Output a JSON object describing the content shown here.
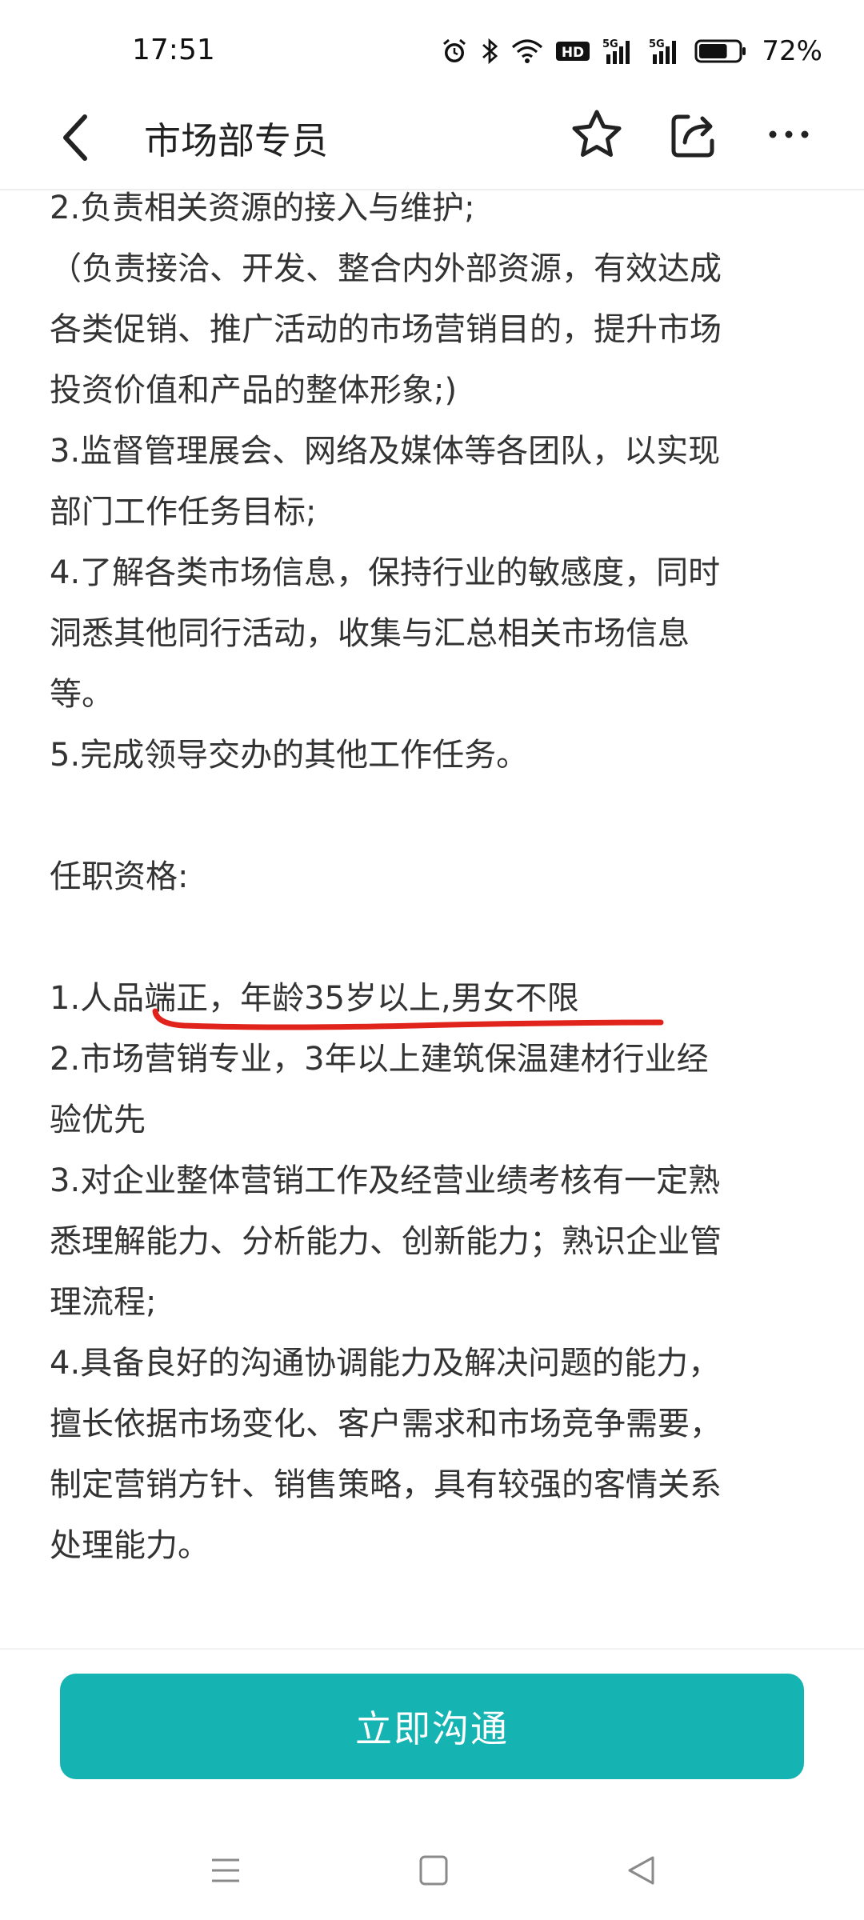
{
  "status_bar": {
    "time": "17:51",
    "network_labels": [
      "HD",
      "5G",
      "5G"
    ],
    "battery_percent": "72%",
    "battery_level": 0.72,
    "icons": [
      "alarm-icon",
      "bluetooth-icon",
      "wifi-icon",
      "hd-icon",
      "signal-5g-icon",
      "signal-5g-icon",
      "battery-icon"
    ]
  },
  "navbar": {
    "title": "市场部专员",
    "icons": [
      "back-arrow-icon",
      "star-icon",
      "share-icon",
      "more-icon"
    ]
  },
  "content": {
    "lines": [
      "2.负责相关资源的接入与维护;",
      "（负责接洽、开发、整合内外部资源，有效达成",
      "各类促销、推广活动的市场营销目的，提升市场",
      "投资价值和产品的整体形象;)",
      "3.监督管理展会、网络及媒体等各团队，以实现",
      "部门工作任务目标;",
      "4.了解各类市场信息，保持行业的敏感度，同时",
      "洞悉其他同行活动，收集与汇总相关市场信息",
      "等。",
      "5.完成领导交办的其他工作任务。",
      "",
      "任职资格:",
      "",
      "1.人品端正，年龄35岁以上,男女不限",
      "2.市场营销专业，3年以上建筑保温建材行业经",
      "验优先",
      "3.对企业整体营销工作及经营业绩考核有一定熟",
      "悉理解能力、分析能力、创新能力；熟识企业管",
      "理流程;",
      "4.具备良好的沟通协调能力及解决问题的能力，",
      "擅长依据市场变化、客户需求和市场竞争需要，",
      "制定营销方针、销售策略，具有较强的客情关系",
      "处理能力。"
    ]
  },
  "annotation": {
    "color": "#e0241b"
  },
  "cta": {
    "label": "立即沟通",
    "color": "#15b3b1"
  },
  "system_nav": {
    "icons": [
      "menu-icon",
      "home-icon",
      "back-icon"
    ]
  }
}
